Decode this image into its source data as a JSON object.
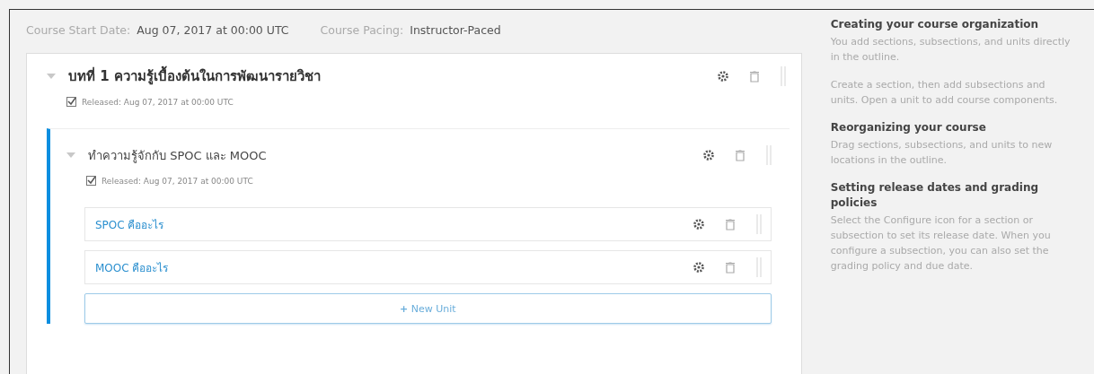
{
  "course_info": [
    {
      "label": "Course Start Date:",
      "value": "Aug 07, 2017 at 00:00 UTC"
    },
    {
      "label": "Course Pacing:",
      "value": "Instructor-Paced"
    }
  ],
  "section": {
    "title": "บทที่ 1 ความรู้เบื้องต้นในการพัฒนารายวิชา",
    "expanded": true,
    "released_checked": true,
    "released": "Released: Aug 07, 2017 at 00:00 UTC",
    "subsections": [
      {
        "title": "ทำความรู้จักกับ SPOC และ MOOC",
        "expanded": true,
        "released_checked": true,
        "released": "Released: Aug 07, 2017 at 00:00 UTC",
        "units": [
          {
            "title": "SPOC คืออะไร"
          },
          {
            "title": "MOOC คืออะไร"
          }
        ],
        "new_unit": {
          "icon": "+",
          "label": "New Unit"
        }
      }
    ]
  },
  "sidebar": [
    {
      "heading": "Creating your course organization",
      "paragraphs": [
        "You add sections, subsections, and units directly in the outline.",
        "Create a section, then add subsections and units. Open a unit to add course components."
      ]
    },
    {
      "heading": "Reorganizing your course",
      "paragraphs": [
        "Drag sections, subsections, and units to new locations in the outline."
      ]
    },
    {
      "heading": "Setting release dates and grading policies",
      "paragraphs": [
        "Select the Configure icon for a section or subsection to set its release date. When you configure a subsection, you can also set the grading policy and due date."
      ]
    }
  ]
}
